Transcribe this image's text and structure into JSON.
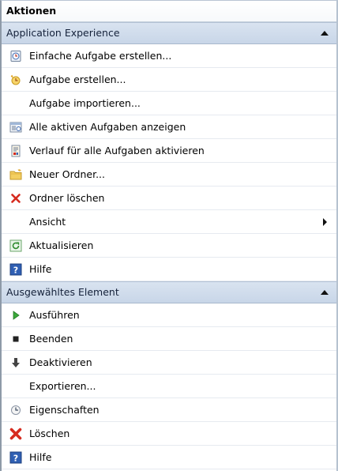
{
  "panel": {
    "title": "Aktionen"
  },
  "section1": {
    "title": "Application Experience",
    "items": [
      {
        "label": "Einfache Aufgabe erstellen...",
        "icon": "create-basic-task-icon"
      },
      {
        "label": "Aufgabe erstellen...",
        "icon": "create-task-icon"
      },
      {
        "label": "Aufgabe importieren...",
        "icon": ""
      },
      {
        "label": "Alle aktiven Aufgaben anzeigen",
        "icon": "running-tasks-icon"
      },
      {
        "label": "Verlauf für alle Aufgaben aktivieren",
        "icon": "history-icon"
      },
      {
        "label": "Neuer Ordner...",
        "icon": "new-folder-icon"
      },
      {
        "label": "Ordner löschen",
        "icon": "delete-icon"
      },
      {
        "label": "Ansicht",
        "icon": ""
      },
      {
        "label": "Aktualisieren",
        "icon": "refresh-icon"
      },
      {
        "label": "Hilfe",
        "icon": "help-icon"
      }
    ]
  },
  "section2": {
    "title": "Ausgewähltes Element",
    "items": [
      {
        "label": "Ausführen",
        "icon": "run-icon"
      },
      {
        "label": "Beenden",
        "icon": "stop-icon"
      },
      {
        "label": "Deaktivieren",
        "icon": "disable-icon"
      },
      {
        "label": "Exportieren...",
        "icon": ""
      },
      {
        "label": "Eigenschaften",
        "icon": "properties-icon"
      },
      {
        "label": "Löschen",
        "icon": "delete-icon"
      },
      {
        "label": "Hilfe",
        "icon": "help-icon"
      }
    ]
  },
  "colors": {
    "header_bg": "#cfdbea",
    "delete_red": "#d62b1f",
    "run_green": "#3aa83a",
    "help_blue": "#2f5fb3"
  }
}
